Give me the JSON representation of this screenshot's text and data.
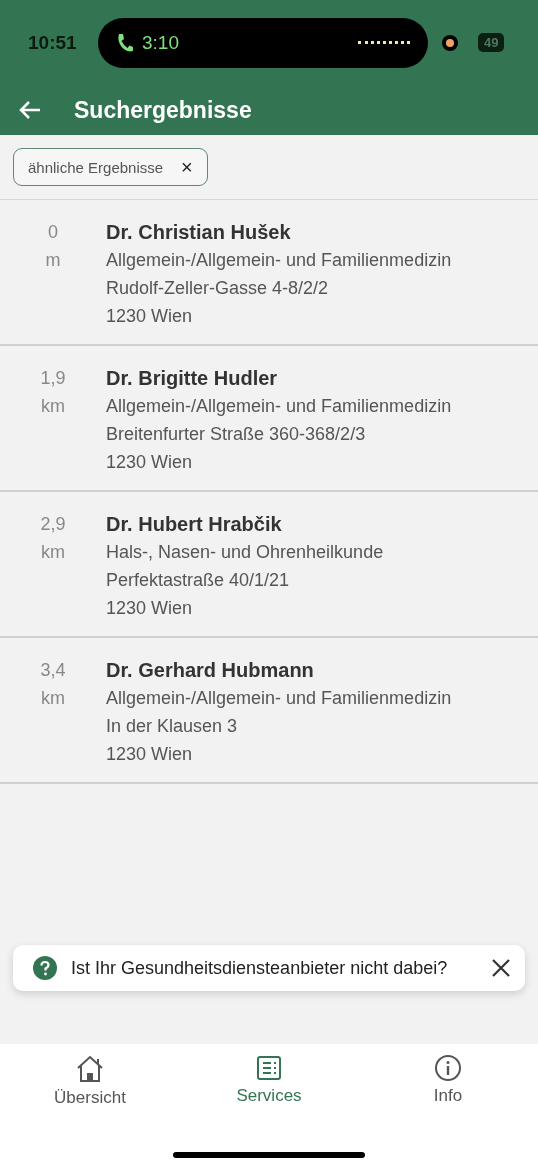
{
  "status_bar": {
    "time": "10:51",
    "call_timer": "3:10",
    "battery": "49"
  },
  "header": {
    "title": "Suchergebnisse"
  },
  "filter_chip": {
    "label": "ähnliche Ergebnisse",
    "close_glyph": "×"
  },
  "results": [
    {
      "distance_value": "0",
      "distance_unit": "m",
      "name": "Dr. Christian Hušek",
      "specialty": "Allgemein-/Allgemein- und Familienmedizin",
      "street": "Rudolf-Zeller-Gasse 4-8/2/2",
      "city": "1230 Wien"
    },
    {
      "distance_value": "1,9",
      "distance_unit": "km",
      "name": "Dr. Brigitte Hudler",
      "specialty": "Allgemein-/Allgemein- und Familienmedizin",
      "street": "Breitenfurter Straße 360-368/2/3",
      "city": "1230 Wien"
    },
    {
      "distance_value": "2,9",
      "distance_unit": "km",
      "name": "Dr. Hubert Hrabčik",
      "specialty": "Hals-, Nasen- und Ohrenheilkunde",
      "street": "Perfektastraße 40/1/21",
      "city": "1230 Wien"
    },
    {
      "distance_value": "3,4",
      "distance_unit": "km",
      "name": "Dr. Gerhard Hubmann",
      "specialty": "Allgemein-/Allgemein- und Familienmedizin",
      "street": "In der Klausen 3",
      "city": "1230 Wien"
    }
  ],
  "toast": {
    "message": "Ist Ihr Gesundheitsdiensteanbieter nicht dabei?"
  },
  "bottom_nav": [
    {
      "kind": "home",
      "label": "Übersicht",
      "selected": false
    },
    {
      "kind": "services",
      "label": "Services",
      "selected": true
    },
    {
      "kind": "info",
      "label": "Info",
      "selected": false
    }
  ]
}
